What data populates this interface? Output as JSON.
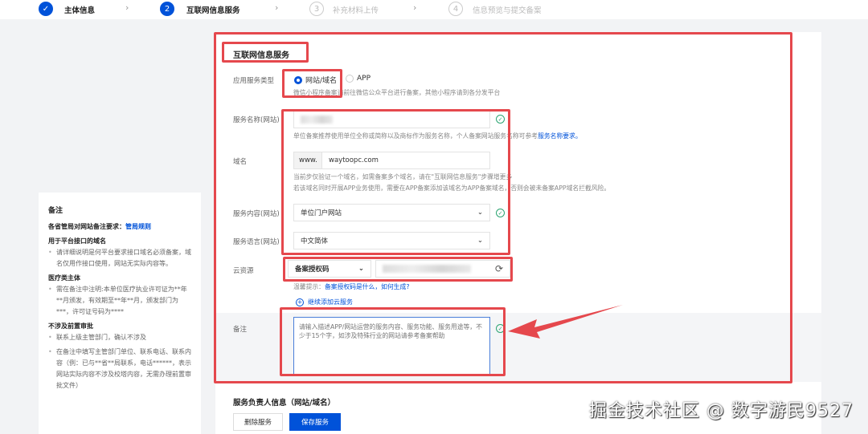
{
  "steps": [
    {
      "num": "✓",
      "label": "主体信息",
      "state": "done"
    },
    {
      "num": "2",
      "label": "互联网信息服务",
      "state": "active"
    },
    {
      "num": "3",
      "label": "补充材料上传",
      "state": "pending"
    },
    {
      "num": "4",
      "label": "信息预览与提交备案",
      "state": "pending"
    }
  ],
  "section_title": "互联网信息服务",
  "form": {
    "app_type": {
      "label": "应用服务类型",
      "options": [
        "网站/域名",
        "APP"
      ],
      "selected": "网站/域名",
      "help": "微信小程序备案请前往微信公众平台进行备案，其他小程序请到各分发平台"
    },
    "service_name": {
      "label": "服务名称(网站)",
      "help": "单位备案推荐使用单位全称或简称以及商标作为服务名称，个人备案网站服务名称可参考",
      "help_link": "服务名称要求。"
    },
    "domain": {
      "label": "域名",
      "prefix": "www.",
      "value": "waytoopc.com",
      "help1": "当前步仅验证一个域名，如需备案多个域名，请在\"互联网信息服务\"步骤增更多",
      "help2": "若该域名同时开展APP业务使用，需要在APP备案添加该域名为APP备案域名，否则会被未备案APP域名拦截风险。"
    },
    "service_content": {
      "label": "服务内容(网站)",
      "value": "单位门户网站"
    },
    "service_language": {
      "label": "服务语言(网站)",
      "value": "中文简体"
    },
    "cloud": {
      "label": "云资源",
      "type": "备案授权码",
      "tip_prefix": "温馨提示：",
      "tip_link": "备案授权码是什么，如何生成?",
      "add": "继续添加云服务"
    },
    "remark": {
      "label": "备注",
      "placeholder": "请输入描述APP/网站运营的服务内容、服务功能、服务用途等，不少于15个字，如涉及特殊行业的网站请参考备案帮助"
    }
  },
  "next_section": "服务负责人信息（网站/域名）",
  "buttons": {
    "delete": "删除服务",
    "save": "保存服务"
  },
  "note": {
    "title": "备注",
    "rule_prefix": "各省管局对网站备注要求：",
    "rule_link": "管局规则",
    "groups": [
      {
        "title": "用于平台接口的域名",
        "items": [
          "请详细说明是何平台要求接口域名必须备案，域名仅用作接口使用，网站无实际内容等。"
        ]
      },
      {
        "title": "医疗类主体",
        "items": [
          "需在备注中注明:本单位医疗执业许可证为**年**月颁发，有效期至**年**月，颁发部门为***，许可证号码为****"
        ]
      },
      {
        "title": "不涉及前置审批",
        "items": [
          "联系上级主管部门，确认不涉及",
          "在备注中填写主管部门单位、联系电话、联系内容（例：已与**省**局联系，电话******，表示网站实际内容不涉及校塔内容，无需办理前置审批文件）"
        ]
      }
    ]
  },
  "watermark": "掘金技术社区 @ 数字游民9527",
  "colors": {
    "primary": "#0052d9",
    "annotation": "#e5484d",
    "success": "#2ba471"
  }
}
